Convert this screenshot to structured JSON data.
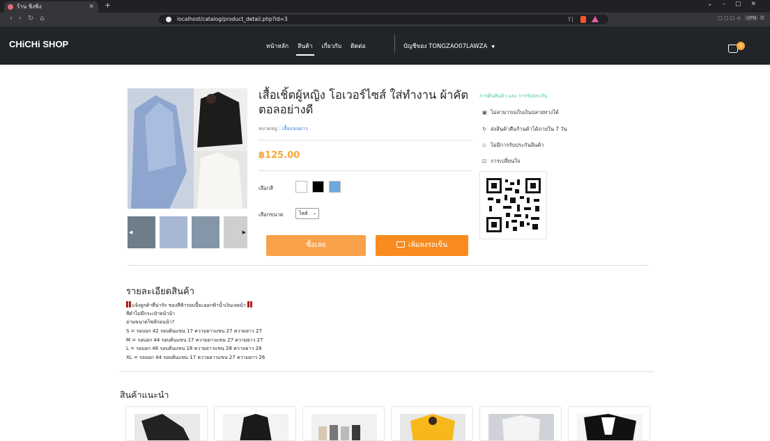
{
  "browser": {
    "tab_title": "ร้าน ชิงชิง",
    "url": "localhost/catalog/product_detail.php?id=3",
    "vpn_label": "VPN"
  },
  "site": {
    "brand": "CHiCHi SHOP",
    "nav": [
      "หน้าหลัก",
      "สินค้า",
      "เกี่ยวกับ",
      "ติดต่อ"
    ],
    "active_nav": "สินค้า",
    "account": "บัญชีของ TONGZAO07LAWZA",
    "cart_count": "0"
  },
  "product": {
    "title": "เสื้อเชิ้ตผู้หญิง โอเวอร์ไซส์ ใส่ทำงาน ผ้าคัตตอลอย่างดี",
    "category_label": "หมวดหมู่ :",
    "category_value": "เสื้อแขนยาว",
    "price": "฿125.00",
    "color_label": "เลือกสี",
    "colors": [
      "#ffffff",
      "#000000",
      "#6fa8dc"
    ],
    "size_label": "เลือกขนาด",
    "size_value": "ไซส์",
    "buy_button": "ซื้อเลย",
    "cart_button": "เพิ่มลงรถเข็น"
  },
  "guarantee": {
    "title": "การคืนสินค้า และ การรับประกัน",
    "items": [
      {
        "icon": "cash-icon",
        "text": "ไม่สามารถเก็บเงินปลายทางได้"
      },
      {
        "icon": "return-icon",
        "text": "ส่งสินค้าคืนร้านค้าได้ภายใน 7 วัน"
      },
      {
        "icon": "shield-icon",
        "text": "ไม่มีการรับประกันสินค้า"
      },
      {
        "icon": "bag-icon",
        "text": "การเปลี่ยนใจ"
      }
    ]
  },
  "details": {
    "title": "รายละเอียดสินค้า",
    "lines": [
      "แจ้งลูกค้าที่น่ารัก ของสีฟ้ารอบนี้จะออกฟ้าน้ำเงินเลยน้า",
      "สีดำไม่มีกระเป๋าหน้าน้า",
      "อ่านขนาดไซส์ก่อนน้า?",
      "S = รอบอก 42 รอบต้นแขน 17 ความยาวแขน 27 ความยาว 27",
      "M = รอบอก 44 รอบต้นแขน 17 ความยาวแขน 27 ความยาว 27",
      "L = รอบอก 46 รอบต้นแขน 18 ความยาวแขน 28 ความยาว 28",
      "XL = รอบอก 44 รอบต้นแขน 17 ความยาวแขน 27 ความยาว 26"
    ]
  },
  "recommended": {
    "title": "สินค้าแนะนำ"
  }
}
